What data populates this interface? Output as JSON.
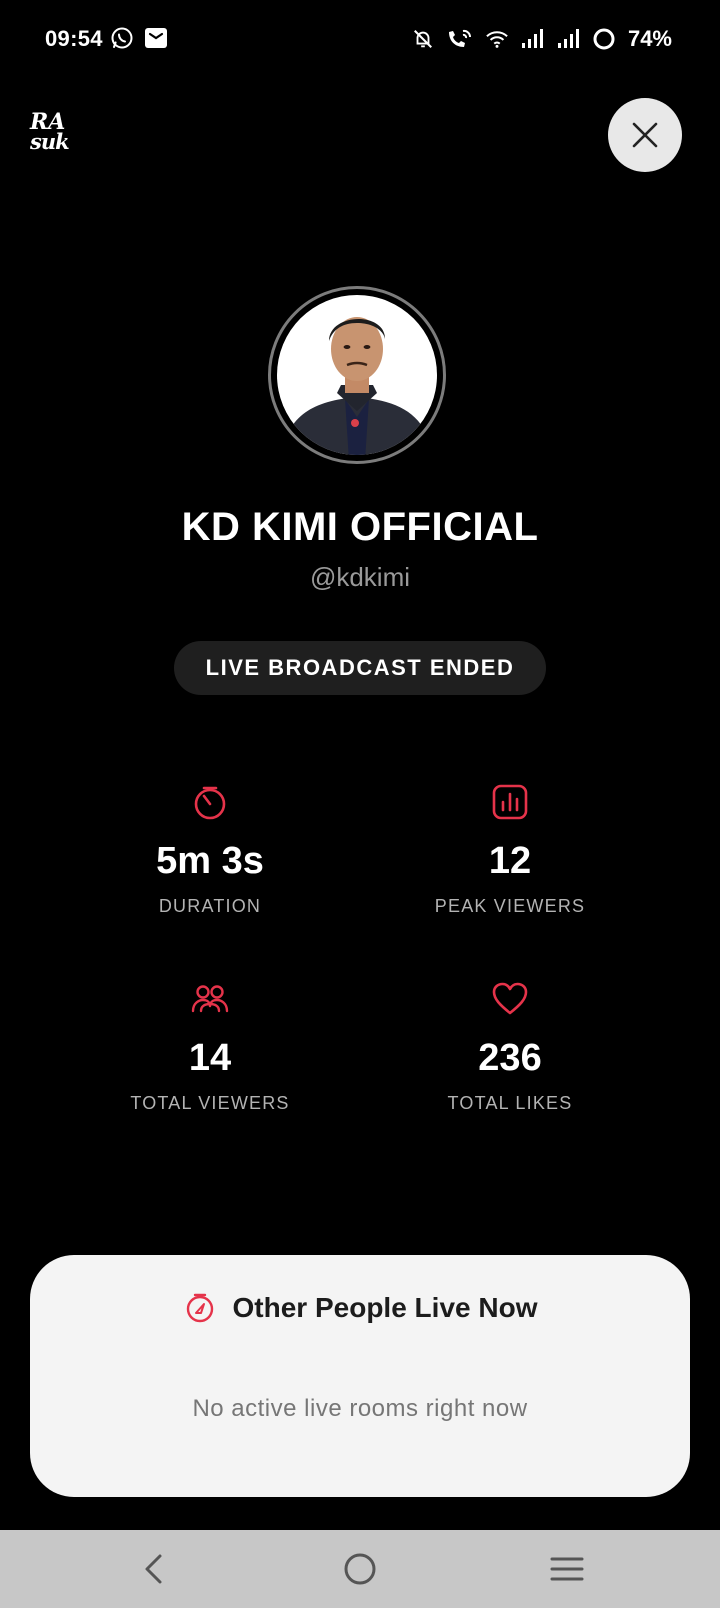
{
  "status_bar": {
    "time": "09:54",
    "left_icons": [
      "whatsapp-icon",
      "mail-icon"
    ],
    "right_icons": [
      "silent-bell-icon",
      "wifi-calling-icon",
      "wifi-icon",
      "signal-icon",
      "signal-icon",
      "battery-ring-icon"
    ],
    "battery": "74%"
  },
  "header": {
    "logo_line1": "RA",
    "logo_line2": "suk",
    "close_icon": "close-icon"
  },
  "profile": {
    "name": "KD KIMI OFFICIAL",
    "username": "@kdkimi",
    "badge": "LIVE BROADCAST ENDED"
  },
  "stats": [
    {
      "icon": "timer-icon",
      "value": "5m 3s",
      "label": "DURATION"
    },
    {
      "icon": "bar-chart-icon",
      "value": "12",
      "label": "PEAK VIEWERS"
    },
    {
      "icon": "users-icon",
      "value": "14",
      "label": "TOTAL VIEWERS"
    },
    {
      "icon": "heart-icon",
      "value": "236",
      "label": "TOTAL LIKES"
    }
  ],
  "live_card": {
    "icon": "compass-icon",
    "title": "Other People Live Now",
    "empty_text": "No active live rooms right now"
  },
  "nav": {
    "icons": [
      "back-icon",
      "home-icon",
      "menu-icon"
    ]
  },
  "colors": {
    "accent": "#e5334a",
    "background": "#000000",
    "card": "#f4f4f4",
    "badge": "#1f1f1f",
    "nav_bar": "#c7c7c7"
  }
}
